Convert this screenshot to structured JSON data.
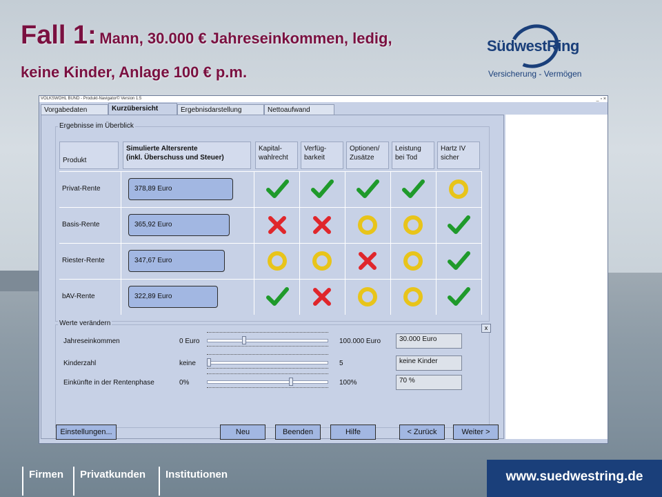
{
  "slide": {
    "title_big": "Fall 1:",
    "title_rest": "Mann, 30.000 € Jahreseinkommen, ledig,",
    "title_line2": "keine Kinder, Anlage 100 € p.m."
  },
  "logo": {
    "name": "SüdwestRing",
    "tagline": "Versicherung - Vermögen"
  },
  "window": {
    "title": "VOLKSWOHL BUND - Produkt-Navigator©  Version 1.5",
    "controls": "_ ▫ ×"
  },
  "tabs": [
    {
      "label": "Vorgabedaten"
    },
    {
      "label": "Kurzübersicht"
    },
    {
      "label": "Ergebnisdarstellung"
    },
    {
      "label": "Nettoaufwand"
    }
  ],
  "overview": {
    "group_label": "Ergebnisse im Überblick",
    "headers": {
      "product": "Produkt",
      "pension": "Simulierte Altersrente\n(inkl. Überschuss und Steuer)",
      "c1": "Kapital-\nwahlrecht",
      "c2": "Verfüg-\nbarkeit",
      "c3": "Optionen/\nZusätze",
      "c4": "Leistung\nbei Tod",
      "c5": "Hartz IV\nsicher"
    },
    "rows": [
      {
        "label": "Privat-Rente",
        "value": "378,89 Euro",
        "ratio": 1.0,
        "marks": [
          "check",
          "check",
          "check",
          "check",
          "circle"
        ]
      },
      {
        "label": "Basis-Rente",
        "value": "365,92 Euro",
        "ratio": 0.966,
        "marks": [
          "cross",
          "cross",
          "circle",
          "circle",
          "check"
        ]
      },
      {
        "label": "Riester-Rente",
        "value": "347,67 Euro",
        "ratio": 0.918,
        "marks": [
          "circle",
          "circle",
          "cross",
          "circle",
          "check"
        ]
      },
      {
        "label": "bAV-Rente",
        "value": "322,89 Euro",
        "ratio": 0.852,
        "marks": [
          "check",
          "cross",
          "circle",
          "circle",
          "check"
        ]
      }
    ],
    "mark_colors": {
      "check": "#1f9a2b",
      "cross": "#e0262b",
      "circle": "#e8c41a"
    }
  },
  "adjust": {
    "group_label": "Werte verändern",
    "close": "x",
    "sliders": [
      {
        "label": "Jahreseinkommen",
        "min": "0 Euro",
        "max": "100.000 Euro",
        "readout": "30.000 Euro",
        "position": 0.3
      },
      {
        "label": "Kinderzahl",
        "min": "keine",
        "max": "5",
        "readout": "keine Kinder",
        "position": 0.0
      },
      {
        "label": "Einkünfte in der Rentenphase",
        "min": "0%",
        "max": "100%",
        "readout": "70 %",
        "position": 0.7
      }
    ]
  },
  "buttons": {
    "settings": "Einstellungen...",
    "new": "Neu",
    "quit": "Beenden",
    "help": "Hilfe",
    "back": "< Zurück",
    "next": "Weiter >"
  },
  "footer": {
    "nav": [
      "Firmen",
      "Privatkunden",
      "Institutionen"
    ],
    "url": "www.suedwestring.de"
  }
}
